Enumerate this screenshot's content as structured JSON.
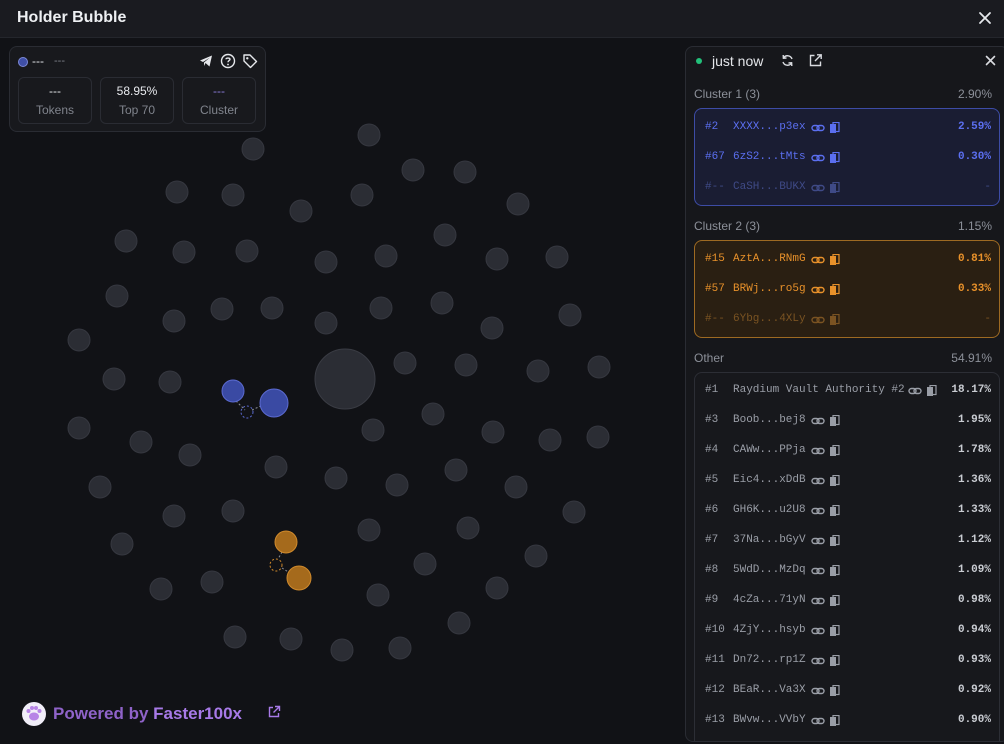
{
  "window": {
    "title": "Holder Bubble"
  },
  "info_card": {
    "name": "---",
    "address": "---",
    "stats": [
      {
        "value": "---",
        "label": "Tokens"
      },
      {
        "value": "58.95%",
        "label": "Top 70"
      },
      {
        "value": "---",
        "label": "Cluster"
      }
    ]
  },
  "footer": {
    "powered_prefix": "Powered by",
    "brand": "Faster100x"
  },
  "panel": {
    "updated": "just now",
    "clusters": [
      {
        "title": "Cluster 1 (3)",
        "percent": "2.90%",
        "rows": [
          {
            "rank": "#2",
            "address": "XXXX...p3ex",
            "percent": "2.59%"
          },
          {
            "rank": "#67",
            "address": "6zS2...tMts",
            "percent": "0.30%"
          },
          {
            "rank": "#--",
            "address": "CaSH...BUKX",
            "percent": "-"
          }
        ]
      },
      {
        "title": "Cluster 2 (3)",
        "percent": "1.15%",
        "rows": [
          {
            "rank": "#15",
            "address": "AztA...RNmG",
            "percent": "0.81%"
          },
          {
            "rank": "#57",
            "address": "BRWj...ro5g",
            "percent": "0.33%"
          },
          {
            "rank": "#--",
            "address": "6Ybg...4XLy",
            "percent": "-"
          }
        ]
      }
    ],
    "other": {
      "title": "Other",
      "percent": "54.91%",
      "rows": [
        {
          "rank": "#1",
          "address": "Raydium Vault Authority #2",
          "percent": "18.17%"
        },
        {
          "rank": "#3",
          "address": "Boob...bej8",
          "percent": "1.95%"
        },
        {
          "rank": "#4",
          "address": "CAWw...PPja",
          "percent": "1.78%"
        },
        {
          "rank": "#5",
          "address": "Eic4...xDdB",
          "percent": "1.36%"
        },
        {
          "rank": "#6",
          "address": "GH6K...u2U8",
          "percent": "1.33%"
        },
        {
          "rank": "#7",
          "address": "37Na...bGyV",
          "percent": "1.12%"
        },
        {
          "rank": "#8",
          "address": "5WdD...MzDq",
          "percent": "1.09%"
        },
        {
          "rank": "#9",
          "address": "4cZa...71yN",
          "percent": "0.98%"
        },
        {
          "rank": "#10",
          "address": "4ZjY...hsyb",
          "percent": "0.94%"
        },
        {
          "rank": "#11",
          "address": "Dn72...rp1Z",
          "percent": "0.93%"
        },
        {
          "rank": "#12",
          "address": "BEaR...Va3X",
          "percent": "0.92%"
        },
        {
          "rank": "#13",
          "address": "BWvw...VVbY",
          "percent": "0.90%"
        }
      ]
    }
  },
  "colors": {
    "bubble_default": "#2b2d34",
    "cluster1": "#3a4aa3",
    "cluster2": "#b87820",
    "accent_purple": "#a87ae8",
    "live_dot": "#22c07a"
  }
}
